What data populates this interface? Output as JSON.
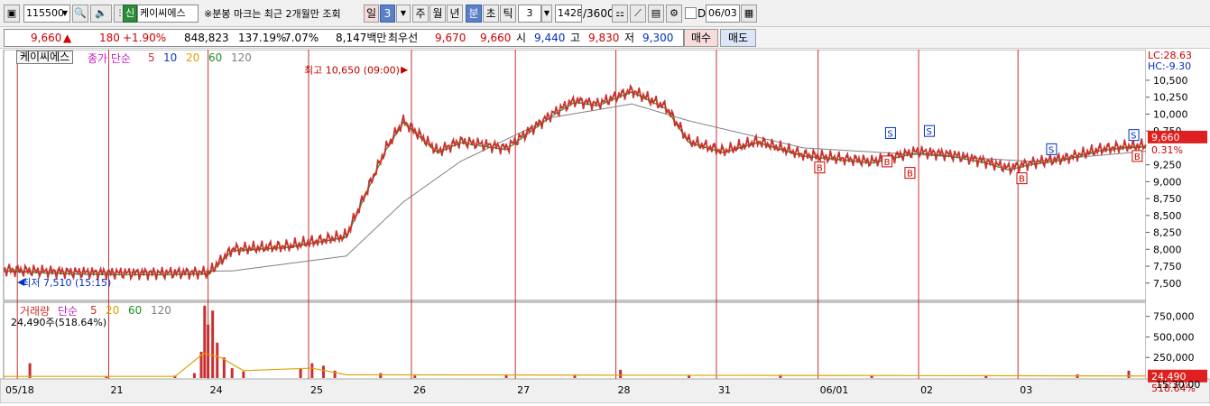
{
  "toolbar": {
    "code": "115500",
    "badge": "신",
    "stock_name": "케이씨에스",
    "notice": "※분봉 마크는 최근 2개월만 조회",
    "period_buttons": [
      "일",
      "3",
      "주",
      "월",
      "년",
      "분",
      "초",
      "틱"
    ],
    "interval_value": "3",
    "count": "1428",
    "count_total": "/3600",
    "d_label": "D",
    "date_value": "06/03"
  },
  "quote": {
    "price": "9,660",
    "arrow": "▲",
    "change": "180",
    "change_pct": "+1.90%",
    "volume": "848,823",
    "vol_ratio": "137.19%",
    "turnover": "7.07%",
    "amount": "8,147백만",
    "best_ask_label": "최우선",
    "best_ask": "9,670",
    "best_bid": "9,660",
    "open_label": "시",
    "open": "9,440",
    "high_label": "고",
    "high": "9,830",
    "low_label": "저",
    "low": "9,300",
    "buy_label": "매수",
    "sell_label": "매도"
  },
  "chart_data": {
    "type": "line",
    "price_panel": {
      "title": "케이씨에스",
      "indicator_label": "종가 단순",
      "ma_periods": [
        "5",
        "10",
        "20",
        "60",
        "120"
      ],
      "ma_colors": [
        "#d03030",
        "#1040c0",
        "#e0a000",
        "#209020",
        "#808080"
      ],
      "ylim": [
        7350,
        10900
      ],
      "yticks": [
        "10,500",
        "10,250",
        "10,000",
        "9,750",
        "9,250",
        "9,000",
        "8,750",
        "8,500",
        "8,250",
        "8,000",
        "7,750",
        "7,500"
      ],
      "high_note": "최고 10,650 (09:00)",
      "low_note": "최저 7,510 (15:15)",
      "lc": "LC:28.63",
      "hc": "HC:-9.30",
      "last_price": "9,660",
      "last_pct": "0.31%",
      "series": [
        {
          "name": "price",
          "x": [
            0,
            6,
            10,
            14,
            18,
            20,
            25,
            30,
            33.5,
            35,
            38,
            40,
            44,
            48,
            50,
            52,
            55,
            58,
            60,
            63,
            66,
            70,
            73,
            76,
            80,
            83,
            86,
            88,
            90,
            93,
            96,
            98,
            100
          ],
          "values": [
            7700,
            7660,
            7650,
            7650,
            7660,
            8000,
            8050,
            8200,
            9500,
            9900,
            9450,
            9600,
            9500,
            10000,
            10200,
            10150,
            10350,
            10100,
            9600,
            9450,
            9600,
            9400,
            9350,
            9300,
            9450,
            9400,
            9300,
            9200,
            9280,
            9350,
            9480,
            9520,
            9540
          ]
        },
        {
          "name": "ma120",
          "x": [
            0,
            10,
            20,
            30,
            35,
            40,
            48,
            55,
            60,
            70,
            80,
            90,
            100
          ],
          "values": [
            7680,
            7660,
            7680,
            7900,
            8700,
            9300,
            9950,
            10150,
            9900,
            9500,
            9400,
            9300,
            9450
          ]
        }
      ],
      "signals": [
        {
          "type": "S",
          "x": 77.6,
          "y": 9720
        },
        {
          "type": "S",
          "x": 81,
          "y": 9750
        },
        {
          "type": "S",
          "x": 91.7,
          "y": 9480
        },
        {
          "type": "S",
          "x": 98.9,
          "y": 9690
        },
        {
          "type": "B",
          "x": 71.4,
          "y": 9210
        },
        {
          "type": "B",
          "x": 77.3,
          "y": 9300
        },
        {
          "type": "B",
          "x": 79.3,
          "y": 9130
        },
        {
          "type": "B",
          "x": 89.1,
          "y": 9050
        },
        {
          "type": "B",
          "x": 99.2,
          "y": 9380
        }
      ]
    },
    "volume_panel": {
      "title": "거래량",
      "indicator_label": "단순",
      "ma_periods": [
        "5",
        "20",
        "60",
        "120"
      ],
      "ma_colors": [
        "#d03030",
        "#e0a000",
        "#209020",
        "#808080"
      ],
      "sub_label": "24,490주(518.64%)",
      "ylim": [
        0,
        900000
      ],
      "yticks": [
        "750,000",
        "500,000",
        "250,000"
      ],
      "last_value": "24,490",
      "last_pct": "518.64%",
      "bars": [
        {
          "x": 2.3,
          "v": 180000
        },
        {
          "x": 9,
          "v": 20000
        },
        {
          "x": 15,
          "v": 30000
        },
        {
          "x": 16.7,
          "v": 60000
        },
        {
          "x": 17.3,
          "v": 320000
        },
        {
          "x": 17.6,
          "v": 880000
        },
        {
          "x": 17.9,
          "v": 650000
        },
        {
          "x": 18.3,
          "v": 820000
        },
        {
          "x": 18.7,
          "v": 430000
        },
        {
          "x": 19.3,
          "v": 250000
        },
        {
          "x": 20,
          "v": 120000
        },
        {
          "x": 21,
          "v": 80000
        },
        {
          "x": 26,
          "v": 120000
        },
        {
          "x": 27,
          "v": 180000
        },
        {
          "x": 28,
          "v": 150000
        },
        {
          "x": 29,
          "v": 90000
        },
        {
          "x": 33,
          "v": 60000
        },
        {
          "x": 36,
          "v": 30000
        },
        {
          "x": 44,
          "v": 40000
        },
        {
          "x": 50,
          "v": 30000
        },
        {
          "x": 54,
          "v": 100000
        },
        {
          "x": 60,
          "v": 30000
        },
        {
          "x": 68,
          "v": 40000
        },
        {
          "x": 76,
          "v": 30000
        },
        {
          "x": 86,
          "v": 25000
        },
        {
          "x": 94,
          "v": 45000
        },
        {
          "x": 98.5,
          "v": 90000
        }
      ]
    },
    "x_axis": {
      "labels": [
        "05/18",
        "21",
        "24",
        "25",
        "26",
        "27",
        "28",
        "31",
        "06/01",
        "02",
        "03"
      ],
      "positions": [
        0,
        9.2,
        17.9,
        26.7,
        35.7,
        44.8,
        53.6,
        62.4,
        71.3,
        80.1,
        88.8
      ],
      "time_label": "15:30:00"
    }
  }
}
